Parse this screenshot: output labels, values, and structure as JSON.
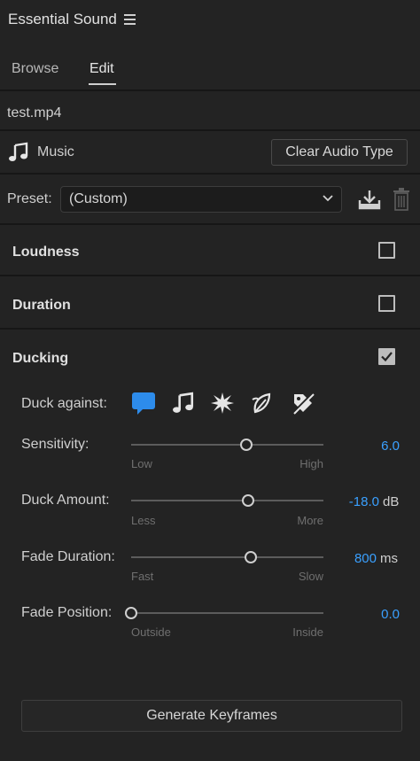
{
  "header": {
    "title": "Essential Sound"
  },
  "tabs": [
    {
      "label": "Browse"
    },
    {
      "label": "Edit",
      "active": true
    }
  ],
  "clip": {
    "filename": "test.mp4",
    "audio_type": "Music",
    "clear_button": "Clear Audio Type"
  },
  "preset": {
    "label": "Preset:",
    "value": "(Custom)"
  },
  "sections": [
    {
      "title": "Loudness",
      "checked": false
    },
    {
      "title": "Duration",
      "checked": false
    },
    {
      "title": "Ducking",
      "checked": true
    }
  ],
  "ducking": {
    "duck_against_label": "Duck against:",
    "duck_against_icons": [
      "dialogue-icon",
      "music-icon",
      "sfx-icon",
      "ambience-icon",
      "unassigned-icon"
    ],
    "active_icon": "dialogue-icon",
    "sliders": [
      {
        "label": "Sensitivity:",
        "low": "Low",
        "high": "High",
        "value": "6.0",
        "unit": "",
        "level": 0.6
      },
      {
        "label": "Duck Amount:",
        "low": "Less",
        "high": "More",
        "value": "-18.0",
        "unit": "dB",
        "level": 0.61
      },
      {
        "label": "Fade Duration:",
        "low": "Fast",
        "high": "Slow",
        "value": "800",
        "unit": "ms",
        "level": 0.62
      },
      {
        "label": "Fade Position:",
        "low": "Outside",
        "high": "Inside",
        "value": "0.0",
        "unit": "",
        "level": 0.0
      }
    ],
    "generate_button": "Generate Keyframes"
  },
  "colors": {
    "accent": "#3aa0ff",
    "background": "#232323",
    "active_icon_bg": "#2d8ceb"
  }
}
